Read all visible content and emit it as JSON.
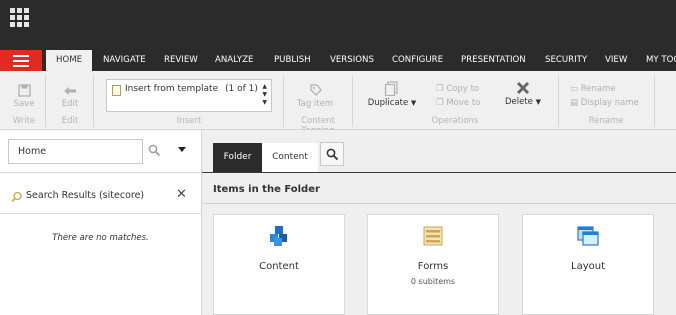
{
  "ribbon_tabs": [
    "HOME",
    "NAVIGATE",
    "REVIEW",
    "ANALYZE",
    "PUBLISH",
    "VERSIONS",
    "CONFIGURE",
    "PRESENTATION",
    "SECURITY",
    "VIEW",
    "MY TOO"
  ],
  "ribbon": {
    "write": {
      "save": "Save",
      "group": "Write"
    },
    "edit": {
      "edit": "Edit",
      "group": "Edit"
    },
    "insert": {
      "template_label": "Insert from template",
      "count": "(1 of 1)",
      "group": "Insert"
    },
    "tagging": {
      "tag_item": "Tag item",
      "group": "Content Tagging"
    },
    "operations": {
      "duplicate": "Duplicate",
      "copy_to": "Copy to",
      "move_to": "Move to",
      "delete": "Delete",
      "group": "Operations"
    },
    "rename": {
      "rename": "Rename",
      "display_name": "Display name",
      "group": "Rename"
    }
  },
  "left_pane": {
    "search_value": "Home",
    "results_title": "Search Results (sitecore)",
    "no_matches": "There are no matches."
  },
  "content": {
    "tab_folder": "Folder",
    "tab_content": "Content",
    "header": "Items in the Folder",
    "cards": [
      {
        "title": "Content",
        "subtitle": "",
        "icon": "blue-cubes-icon"
      },
      {
        "title": "Forms",
        "subtitle": "0 subitems",
        "icon": "form-icon"
      },
      {
        "title": "Layout",
        "subtitle": "",
        "icon": "layout-windows-icon"
      }
    ]
  },
  "colors": {
    "topbar": "#2b2b2b",
    "accent_red": "#e02b20",
    "ribbon_bg": "#f0f0f0"
  }
}
